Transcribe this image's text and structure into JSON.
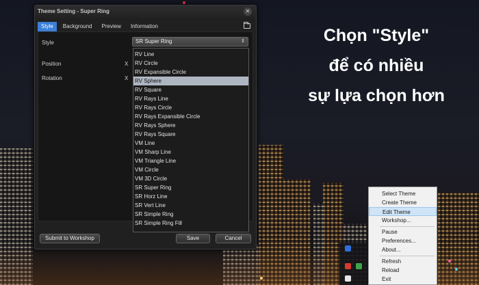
{
  "caption": {
    "line1": "Chọn \"Style\"",
    "line2": "để có nhiều",
    "line3": "sự lựa chọn hơn"
  },
  "window": {
    "title": "Theme Setting - Super Ring",
    "close_glyph": "✕",
    "tabs": [
      "Style",
      "Background",
      "Preview",
      "Information"
    ],
    "active_tab": "Style",
    "fields": {
      "style_label": "Style",
      "position_label": "Position",
      "rotation_label": "Rotation",
      "x_label": "X"
    },
    "style_select": {
      "value": "SR Super Ring",
      "arrows": "⇕"
    },
    "style_options": [
      "RV Line",
      "RV Circle",
      "RV Expansible Circle",
      "RV Sphere",
      "RV Square",
      "RV Rays Line",
      "RV Rays Circle",
      "RV Rays Expansible Circle",
      "RV Rays Sphere",
      "RV Rays Square",
      "VM Line",
      "VM Sharp Line",
      "VM Triangle Line",
      "VM Circle",
      "VM 3D Circle",
      "SR Super Ring",
      "SR Horz Line",
      "SR Vert Line",
      "SR Simple Ring",
      "SR Simple Ring Fill"
    ],
    "highlighted_option": "RV Sphere",
    "buttons": {
      "submit": "Submit to Workshop",
      "save": "Save",
      "cancel": "Cancel"
    }
  },
  "tray_menu": {
    "groups": [
      [
        "Select Theme",
        "Create Theme",
        "Edit Theme",
        "Workshop..."
      ],
      [
        "Pause",
        "Preferences...",
        "About..."
      ],
      [
        "Refresh",
        "Reload",
        "Exit"
      ]
    ],
    "highlighted": "Edit Theme"
  },
  "colors": {
    "tab_active": "#3b7fd6",
    "option_highlight": "#aeb6c2",
    "menu_highlight": "#cfe4f7"
  }
}
